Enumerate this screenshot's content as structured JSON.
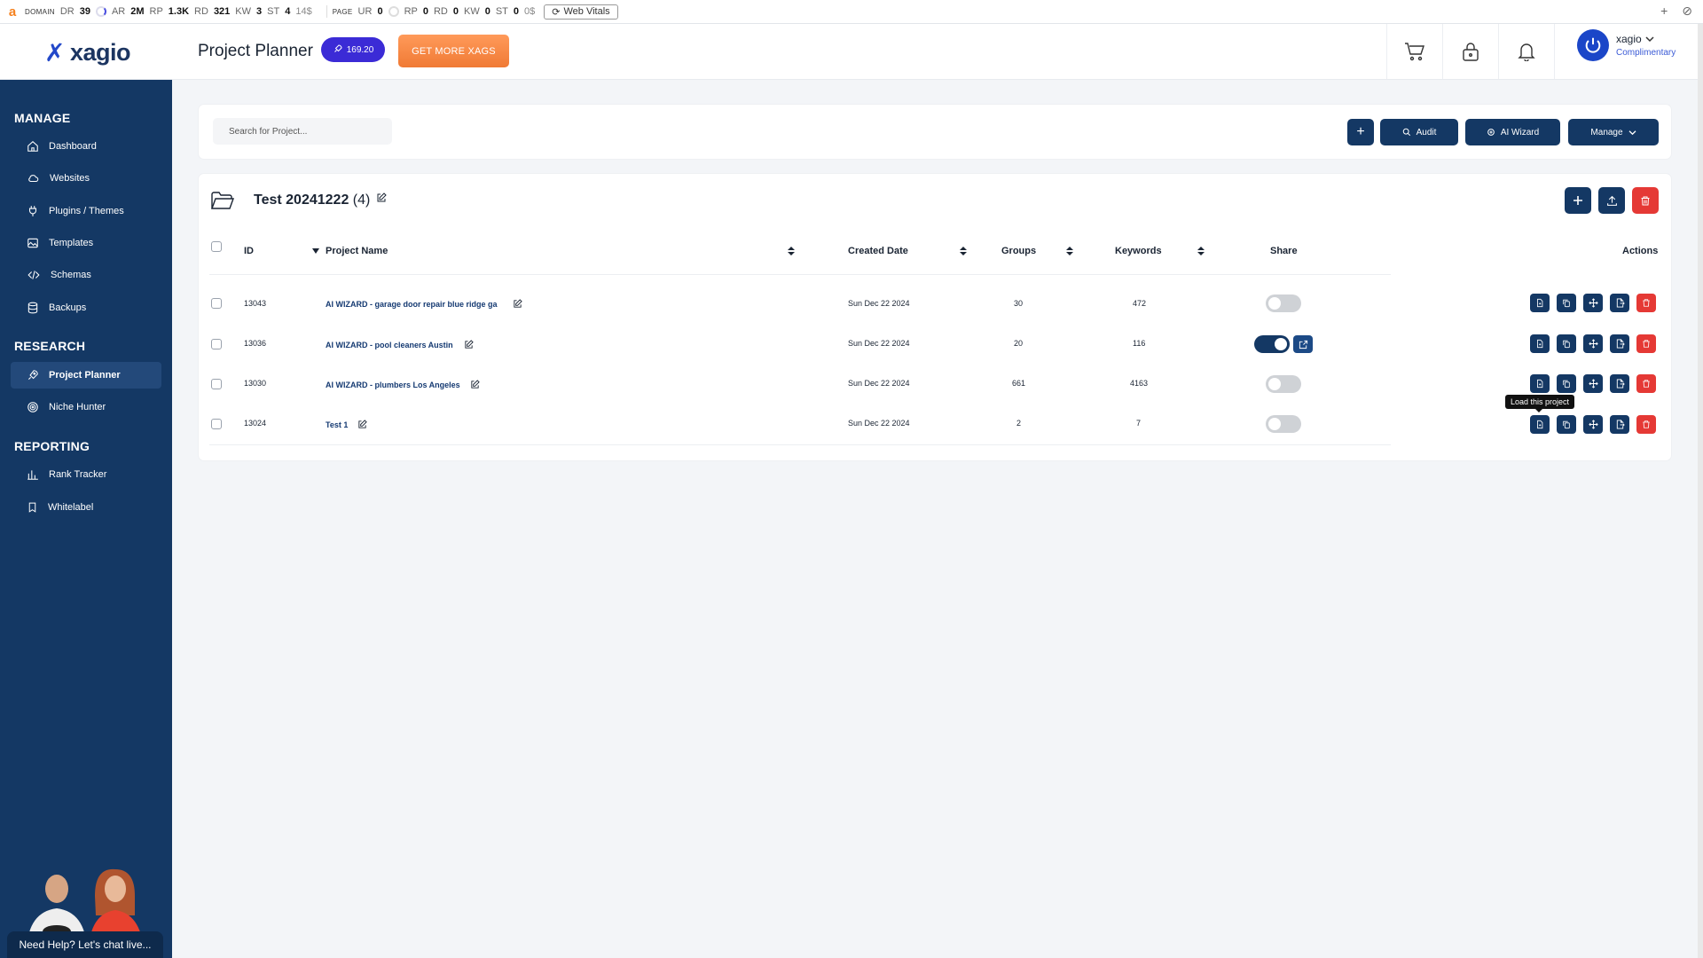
{
  "seobar": {
    "domain_label": "DOMAIN",
    "dr_k": "DR",
    "dr_v": "39",
    "ar_k": "AR",
    "ar_v": "2M",
    "rp_k": "RP",
    "rp_v": "1.3K",
    "rd_k": "RD",
    "rd_v": "321",
    "kw_k": "KW",
    "kw_v": "3",
    "st_k": "ST",
    "st_v": "4",
    "st_cost": "14$",
    "page_label": "PAGE",
    "ur_k": "UR",
    "ur_v": "0",
    "prp_k": "RP",
    "prp_v": "0",
    "prd_k": "RD",
    "prd_v": "0",
    "pkw_k": "KW",
    "pkw_v": "0",
    "pst_k": "ST",
    "pst_v": "0",
    "pst_cost": "0$",
    "web_vitals": "Web Vitals"
  },
  "header": {
    "brand": "xagio",
    "page_title": "Project Planner",
    "xag_balance": "169.20",
    "get_more_label": "GET MORE XAGS",
    "account_name": "xagio",
    "account_plan": "Complimentary"
  },
  "sidebar": {
    "sections": [
      {
        "title": "MANAGE"
      },
      {
        "title": "RESEARCH"
      },
      {
        "title": "REPORTING"
      }
    ],
    "items": [
      {
        "label": "Dashboard",
        "icon": "home-icon"
      },
      {
        "label": "Websites",
        "icon": "cloud-icon"
      },
      {
        "label": "Plugins / Themes",
        "icon": "plug-icon"
      },
      {
        "label": "Templates",
        "icon": "image-icon"
      },
      {
        "label": "Schemas",
        "icon": "code-icon"
      },
      {
        "label": "Backups",
        "icon": "database-icon"
      },
      {
        "label": "Project Planner",
        "icon": "rocket-icon",
        "active": true
      },
      {
        "label": "Niche Hunter",
        "icon": "target-icon"
      },
      {
        "label": "Rank Tracker",
        "icon": "bar-chart-icon"
      },
      {
        "label": "Whitelabel",
        "icon": "bookmark-icon"
      }
    ],
    "chat_label": "Need Help? Let's chat live..."
  },
  "toolbar": {
    "search_placeholder": "Search for Project...",
    "add_label": "+",
    "audit_label": "Audit",
    "ai_wizard_label": "AI Wizard",
    "manage_label": "Manage"
  },
  "folder": {
    "name": "Test 20241222",
    "count": "(4)"
  },
  "table": {
    "columns": {
      "id": "ID",
      "name": "Project Name",
      "created": "Created Date",
      "groups": "Groups",
      "keywords": "Keywords",
      "share": "Share",
      "actions": "Actions"
    },
    "rows": [
      {
        "id": "13043",
        "name": "AI WIZARD - garage door repair blue ridge ga",
        "created": "Sun Dec 22 2024",
        "groups": "30",
        "keywords": "472",
        "shared": false
      },
      {
        "id": "13036",
        "name": "AI WIZARD - pool cleaners Austin",
        "created": "Sun Dec 22 2024",
        "groups": "20",
        "keywords": "116",
        "shared": true
      },
      {
        "id": "13030",
        "name": "AI WIZARD - plumbers Los Angeles",
        "created": "Sun Dec 22 2024",
        "groups": "661",
        "keywords": "4163",
        "shared": false
      },
      {
        "id": "13024",
        "name": "Test 1",
        "created": "Sun Dec 22 2024",
        "groups": "2",
        "keywords": "7",
        "shared": false
      }
    ]
  },
  "tooltip": "Load this project",
  "colors": {
    "navy": "#143864",
    "accent_blue": "#3b2bd6",
    "orange": "#f07a35",
    "danger": "#e53935"
  }
}
